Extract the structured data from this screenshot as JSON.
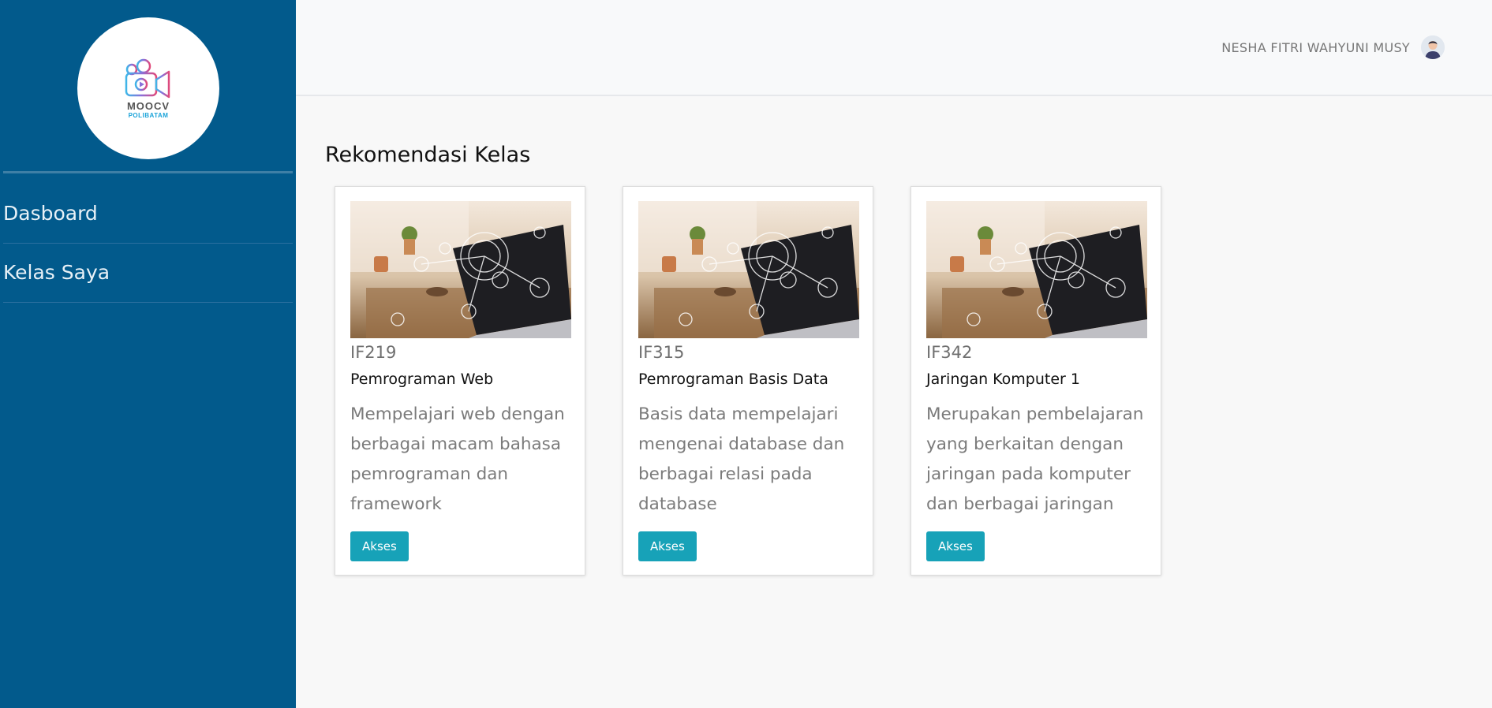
{
  "brand": {
    "logo_text": "MOOCV",
    "logo_sub": "POLIBATAM"
  },
  "sidebar": {
    "items": [
      {
        "label": "Dasboard"
      },
      {
        "label": "Kelas Saya"
      }
    ]
  },
  "header": {
    "user_name": "NESHA FITRI WAHYUNI MUSY"
  },
  "main": {
    "section_title": "Rekomendasi Kelas",
    "cards": [
      {
        "code": "IF219",
        "title": "Pemrograman Web",
        "description": "Mempelajari web dengan berbagai macam bahasa pemrograman dan framework",
        "button": "Akses"
      },
      {
        "code": "IF315",
        "title": "Pemrograman Basis Data",
        "description": "Basis data mempelajari mengenai database dan berbagai relasi pada database",
        "button": "Akses"
      },
      {
        "code": "IF342",
        "title": "Jaringan Komputer 1",
        "description": "Merupakan pembelajaran yang berkaitan dengan jaringan pada komputer dan berbagai jaringan",
        "button": "Akses"
      }
    ]
  },
  "colors": {
    "sidebar": "#025a8c",
    "accent": "#17a2b8",
    "background": "#f8f8f8"
  },
  "icons": {
    "logo": "video-camera-icon",
    "avatar": "user-avatar-icon"
  }
}
